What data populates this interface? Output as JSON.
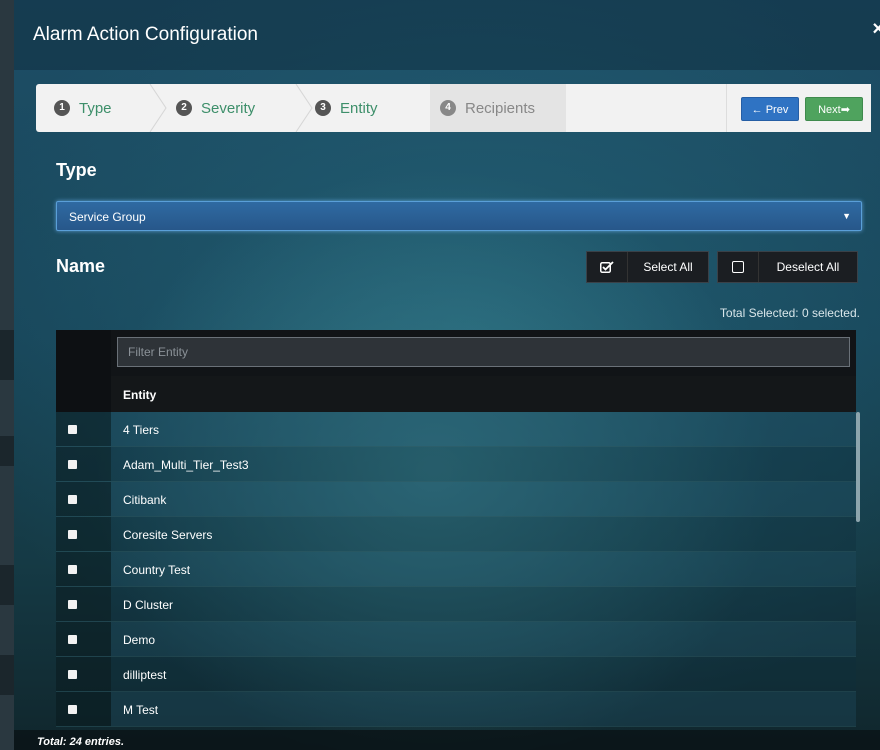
{
  "modal": {
    "title": "Alarm Action Configuration",
    "close_icon": "close-icon"
  },
  "wizard": {
    "steps": [
      {
        "number": "1",
        "label": "Type"
      },
      {
        "number": "2",
        "label": "Severity"
      },
      {
        "number": "3",
        "label": "Entity"
      },
      {
        "number": "4",
        "label": "Recipients"
      }
    ],
    "prev_label": "← Prev",
    "next_label": "Next➡"
  },
  "type_section": {
    "label": "Type",
    "selected": "Service Group"
  },
  "name_section": {
    "label": "Name",
    "select_all_label": "Select All",
    "deselect_all_label": "Deselect All",
    "total_selected": "Total Selected: 0 selected."
  },
  "table": {
    "filter_placeholder": "Filter Entity",
    "column_entity": "Entity",
    "rows": [
      "4 Tiers",
      "Adam_Multi_Tier_Test3",
      "Citibank",
      "Coresite Servers",
      "Country Test",
      "D Cluster",
      "Demo",
      "dilliptest",
      "M Test"
    ],
    "total_entries": "Total: 24 entries."
  },
  "colors": {
    "step_done": "#3d8f6a",
    "prev_button": "#2f73c3",
    "next_button": "#4fa35e"
  }
}
